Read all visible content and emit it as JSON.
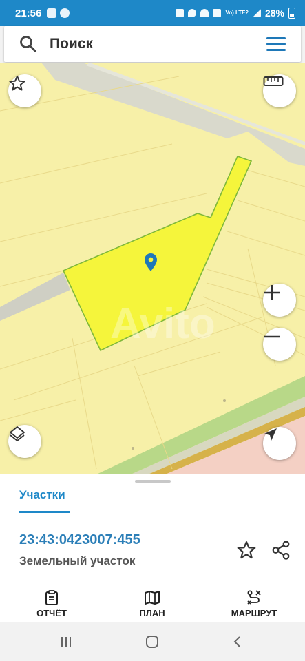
{
  "status_bar": {
    "time": "21:56",
    "network": "Vo) LTE2",
    "battery": "28%"
  },
  "search": {
    "label": "Поиск"
  },
  "map": {
    "watermark": "Avito",
    "parcel_color": "#f5f53b",
    "parcel_border": "#7fb83a",
    "pin_color": "#1e78b8"
  },
  "sheet": {
    "tab": "Участки",
    "cadastral_number": "23:43:0423007:455",
    "parcel_type": "Земельный участок"
  },
  "bottom_nav": {
    "report": "ОТЧЁТ",
    "plan": "ПЛАН",
    "route": "МАРШРУТ"
  },
  "colors": {
    "accent": "#1e88c8",
    "map_bg": "#f7f0a8"
  }
}
